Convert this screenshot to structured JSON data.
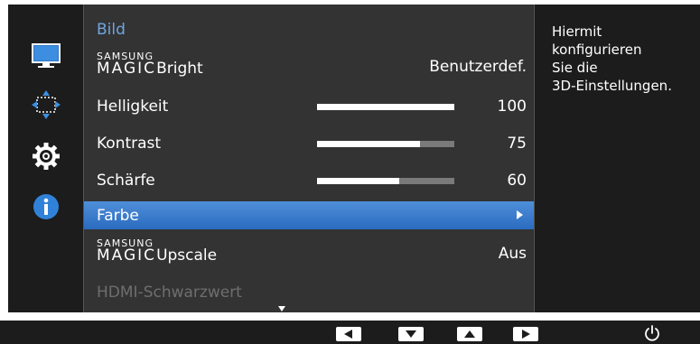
{
  "menu": {
    "title": "Bild",
    "magic_brand": "SAMSUNG",
    "magic_word": "MAGIC",
    "items": [
      {
        "magic": true,
        "label": "Bright",
        "value": "Benutzerdef."
      },
      {
        "label": "Helligkeit",
        "value": "100",
        "level": 100
      },
      {
        "label": "Kontrast",
        "value": "75",
        "level": 75
      },
      {
        "label": "Schärfe",
        "value": "60",
        "level": 60
      },
      {
        "label": "Farbe",
        "selected": true,
        "has_submenu": true
      },
      {
        "magic": true,
        "label": "Upscale",
        "value": "Aus"
      },
      {
        "label": "HDMI-Schwarzwert",
        "disabled": true
      }
    ]
  },
  "help_text": [
    "Hiermit",
    "konfigurieren",
    "Sie die",
    "3D-Einstellungen."
  ],
  "sidebar": {
    "icons": [
      "monitor-icon",
      "resize-arrows-icon",
      "gear-icon",
      "info-icon"
    ],
    "active_icon": "monitor-icon"
  },
  "bottom_bar": {
    "buttons": [
      "left-arrow",
      "down-arrow",
      "up-arrow",
      "right-arrow",
      "power"
    ]
  },
  "colors": {
    "accent": "#3f82d2",
    "title": "#6ea6df",
    "panel": "#333333",
    "background": "#1c1c1c"
  }
}
